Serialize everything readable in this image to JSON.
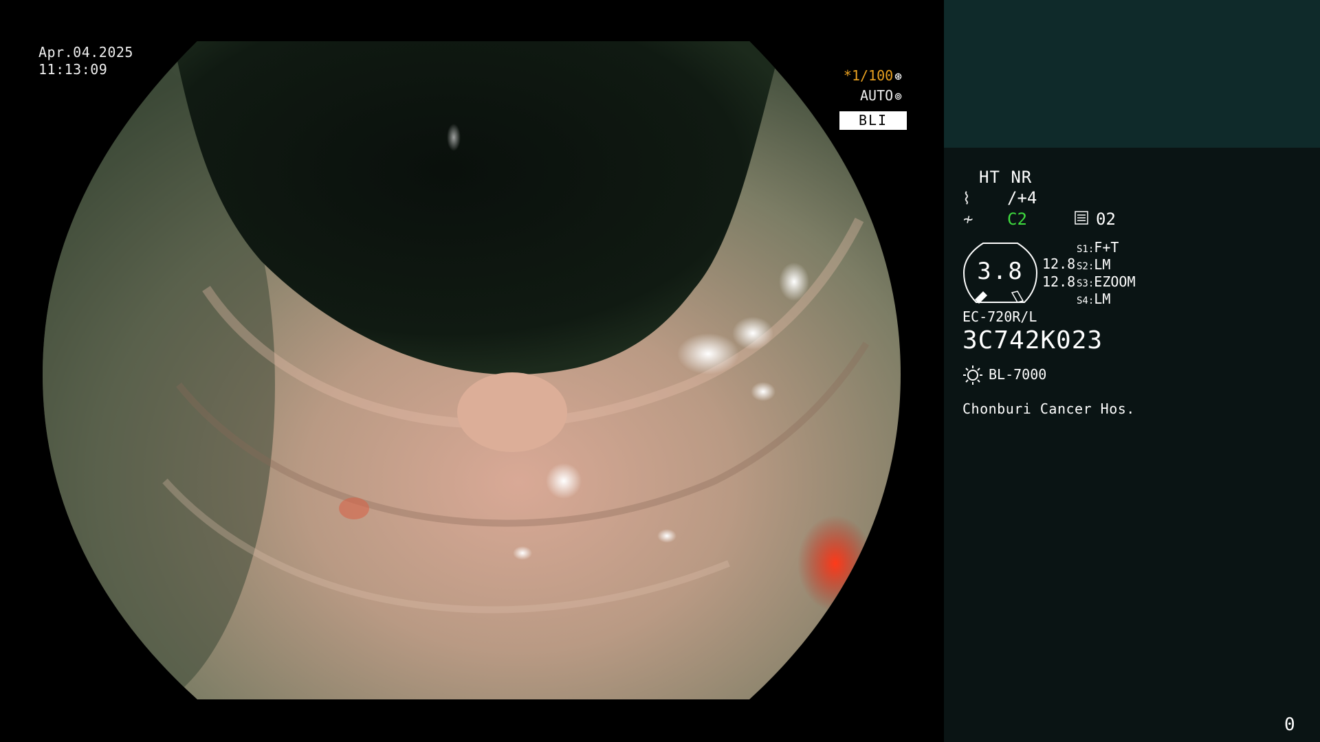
{
  "overlay": {
    "date": "Apr.04.2025",
    "time": "11:13:09",
    "shutter": "*1/100",
    "shutter_icon": "shutter-icon",
    "iris": "AUTO",
    "iris_icon": "iris-icon",
    "mode": "BLI"
  },
  "panel": {
    "processing": "HT NR",
    "structure_enhancement": "/+4",
    "color_enhancement": "C2",
    "memory": "02",
    "zoom": "3.8",
    "zoom_values": [
      "12.8",
      "12.8"
    ],
    "switches": [
      {
        "key": "S1:",
        "value": "F+T"
      },
      {
        "key": "S2:",
        "value": "LM"
      },
      {
        "key": "S3:",
        "value": "EZOOM"
      },
      {
        "key": "S4:",
        "value": "LM"
      }
    ],
    "scope_model": "EC-720R/L",
    "serial": "3C742K023",
    "light_source": "BL-7000",
    "hospital": "Chonburi Cancer Hos.",
    "counter": "0"
  },
  "colors": {
    "shutter": "#e8a020",
    "color_enhancement": "#3fdc3f",
    "panel_bg": "#0a1414",
    "panel_top_bg": "#0f2a2a"
  }
}
